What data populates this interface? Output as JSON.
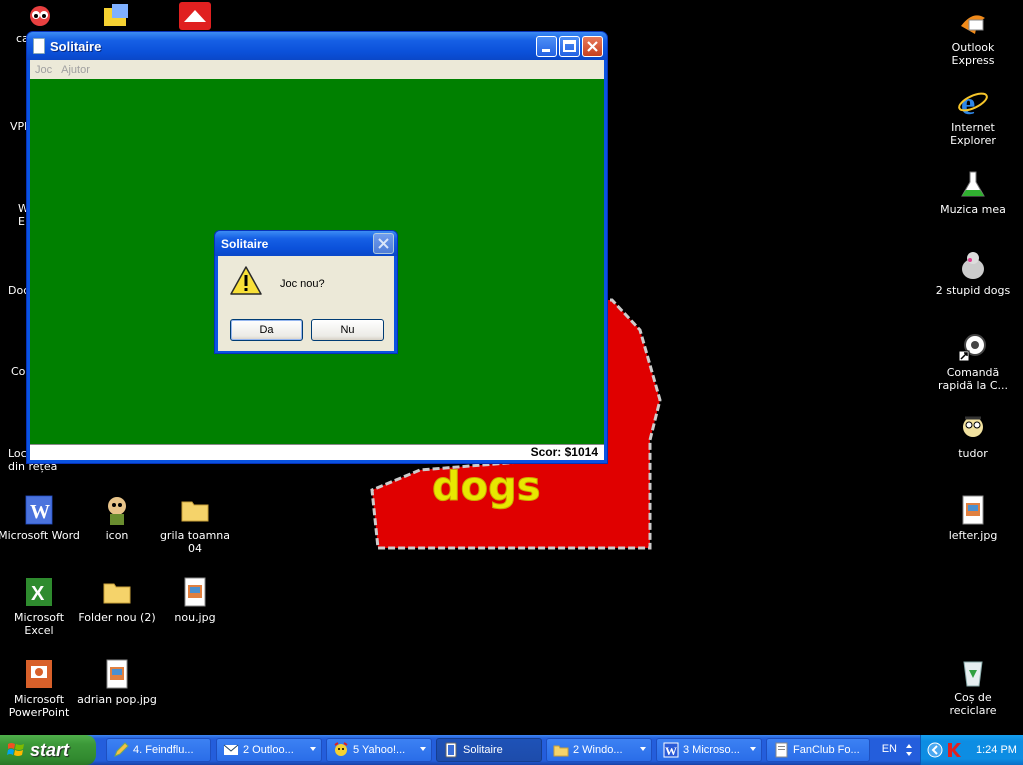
{
  "desktop": {
    "left_icons_cut": [
      {
        "name": "desktop-icon-cut-ca",
        "label": "ca",
        "icon": "powerpuff-icon"
      },
      {
        "name": "desktop-icon-cut-vpl",
        "label": "VPl",
        "icon": "program-icon"
      },
      {
        "name": "desktop-icon-cut-w",
        "label": "W\nE",
        "icon": "program-icon"
      },
      {
        "name": "desktop-icon-cut-doc",
        "label": "Doc",
        "icon": "documents-icon"
      },
      {
        "name": "desktop-icon-cut-co",
        "label": "Co",
        "icon": "computer-icon"
      },
      {
        "name": "desktop-icon-cut-loc",
        "label": "Loc\ndin rețea",
        "icon": "network-icon"
      }
    ],
    "left_icons": [
      {
        "label": "Microsoft Word",
        "icon": "word-icon"
      },
      {
        "label": "icon",
        "icon": "cartoon-icon"
      },
      {
        "label": "grila toamna 04",
        "icon": "folder-icon"
      },
      {
        "label": "Microsoft Excel",
        "icon": "excel-icon"
      },
      {
        "label": "Folder nou (2)",
        "icon": "folder-icon"
      },
      {
        "label": "nou.jpg",
        "icon": "image-file-icon"
      },
      {
        "label": "Microsoft PowerPoint",
        "icon": "powerpoint-icon"
      },
      {
        "label": "adrian pop.jpg",
        "icon": "image-file-icon"
      }
    ],
    "right_icons": [
      {
        "label": "Outlook Express",
        "icon": "outlook-express-icon"
      },
      {
        "label": "Internet Explorer",
        "icon": "internet-explorer-icon"
      },
      {
        "label": "Muzica mea",
        "icon": "music-icon"
      },
      {
        "label": "2 stupid dogs",
        "icon": "dog-icon"
      },
      {
        "label": "Comandă rapidă la C...",
        "icon": "shortcut-icon"
      },
      {
        "label": "tudor",
        "icon": "cartoon-icon"
      },
      {
        "label": "lefter.jpg",
        "icon": "image-file-icon"
      },
      {
        "label": "Coș de reciclare",
        "icon": "recycle-bin-icon"
      }
    ],
    "wallpaper_text": "dogs"
  },
  "solitaire": {
    "title": "Solitaire",
    "menu": [
      "Joc",
      "Ajutor"
    ],
    "status": "Scor: $1014",
    "felt_color": "#008000"
  },
  "dialog": {
    "title": "Solitaire",
    "message": "Joc nou?",
    "yes_label": "Da",
    "no_label": "Nu",
    "icon": "warning-icon"
  },
  "taskbar": {
    "start_label": "start",
    "tasks": [
      {
        "label": "4. Feindflu...",
        "icon": "pencil-icon",
        "active": false,
        "group": false
      },
      {
        "label": "2 Outloo...",
        "icon": "outlook-icon",
        "active": false,
        "group": true
      },
      {
        "label": "5 Yahoo!...",
        "icon": "yahoo-messenger-icon",
        "active": false,
        "group": true
      },
      {
        "label": "Solitaire",
        "icon": "solitaire-icon",
        "active": true,
        "group": false
      },
      {
        "label": "2 Windo...",
        "icon": "folder-icon",
        "active": false,
        "group": true
      },
      {
        "label": "3 Microso...",
        "icon": "word-icon",
        "active": false,
        "group": true
      },
      {
        "label": "FanClub Fo...",
        "icon": "document-icon",
        "active": false,
        "group": false
      }
    ],
    "language": "EN",
    "clock": "1:24 PM"
  },
  "colors": {
    "xp_blue": "#245EDC",
    "start_green": "#3C9939",
    "felt": "#008000",
    "wallpaper_red": "#E00000",
    "wallpaper_yellow": "#E8E800"
  }
}
